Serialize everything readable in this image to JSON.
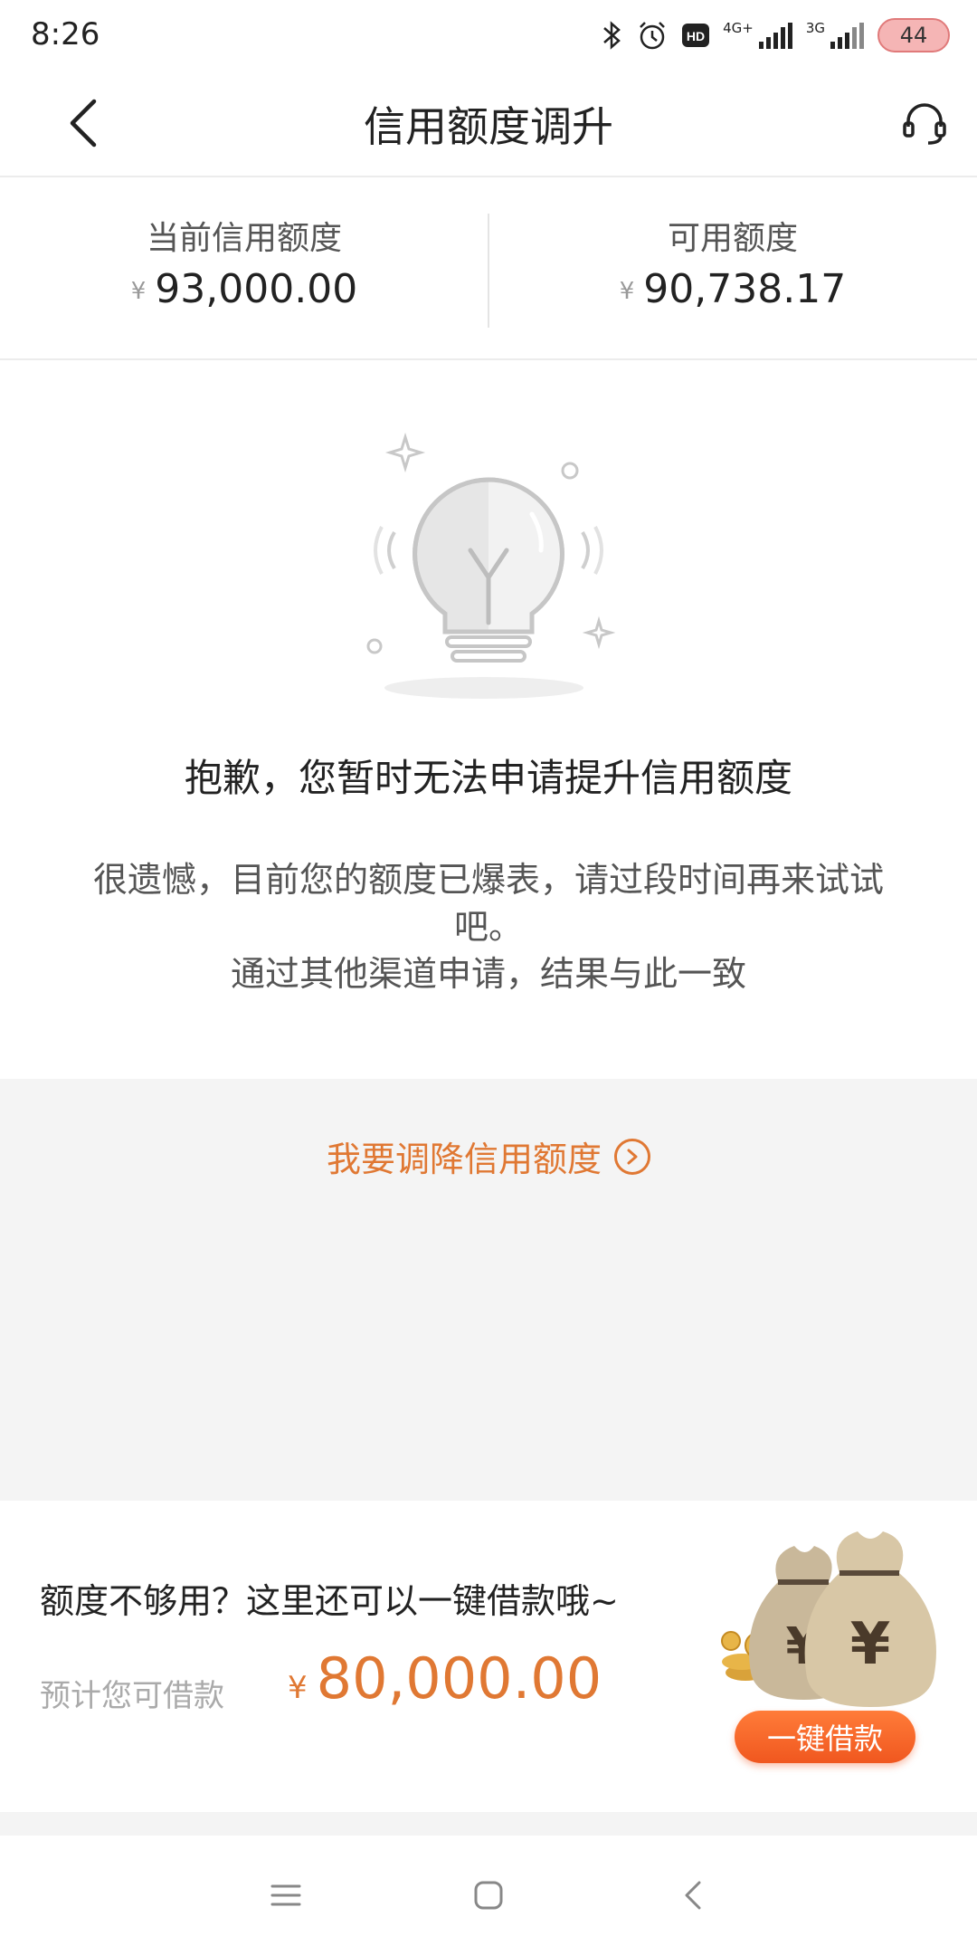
{
  "status_bar": {
    "time": "8:26",
    "network_1": "4G+",
    "network_2": "3G",
    "battery": "44",
    "icons": [
      "bluetooth-icon",
      "alarm-icon",
      "hd-icon",
      "signal-icon",
      "battery-icon"
    ]
  },
  "header": {
    "title": "信用额度调升"
  },
  "summary": {
    "current_limit_label": "当前信用额度",
    "current_limit_currency": "¥",
    "current_limit_value": "93,000.00",
    "available_label": "可用额度",
    "available_currency": "¥",
    "available_value": "90,738.17"
  },
  "message": {
    "title": "抱歉，您暂时无法申请提升信用额度",
    "line1": "很遗憾，目前您的额度已爆表，请过段时间再来试试吧。",
    "line2": "通过其他渠道申请，结果与此一致"
  },
  "lower_limit_link": "我要调降信用额度",
  "loan": {
    "title": "额度不够用？这里还可以一键借款哦~",
    "estimate_label": "预计您可借款",
    "currency": "¥",
    "amount": "80,000.00",
    "button_label": "一键借款"
  },
  "colors": {
    "accent": "#e07833",
    "button": "#f0571f",
    "divider": "#ececec",
    "gray_bg": "#f4f4f4"
  }
}
